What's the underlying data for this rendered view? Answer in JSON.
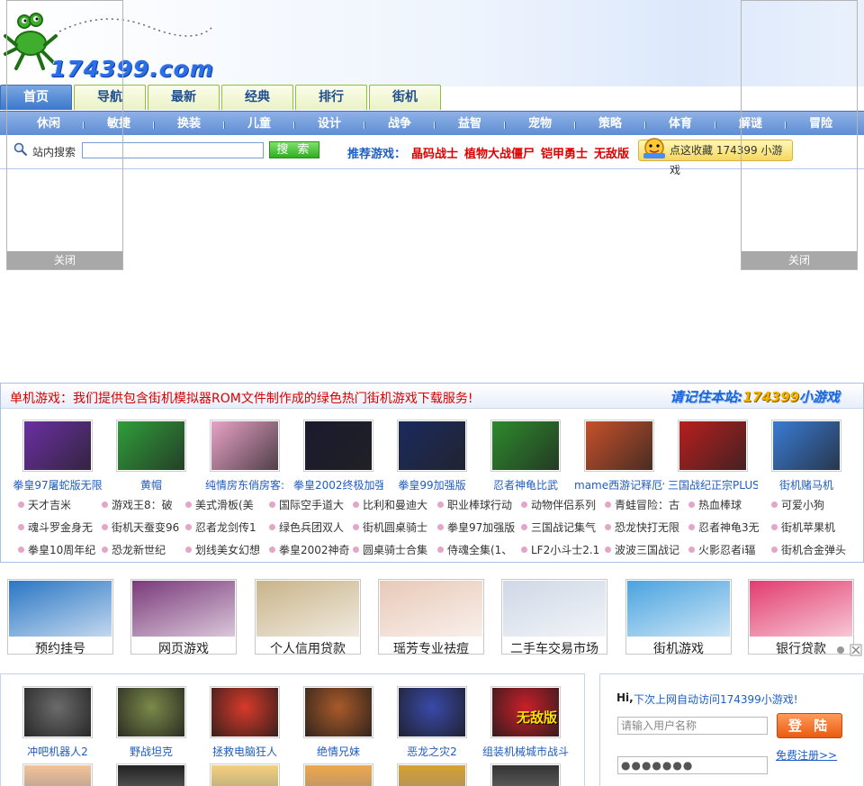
{
  "site": {
    "logo_text": "174399.com"
  },
  "tabs": [
    "首页",
    "导航",
    "最新",
    "经典",
    "排行",
    "街机"
  ],
  "subnav": [
    "休闲",
    "敏捷",
    "换装",
    "儿童",
    "设计",
    "战争",
    "益智",
    "宠物",
    "策略",
    "体育",
    "解谜",
    "冒险"
  ],
  "search": {
    "label": "站内搜索",
    "button": "搜 索",
    "recommend_label": "推荐游戏：",
    "recommend": [
      "晶码战士",
      "植物大战僵尸",
      "铠甲勇士",
      "无敌版"
    ],
    "favorite": "点这收藏 174399 小游戏"
  },
  "float_ads": {
    "close_left": "关闭",
    "close_right": "关闭"
  },
  "pc_section": {
    "title": "单机游戏：我们提供包含街机模拟器ROM文件制作成的绿色热门街机游戏下载服务!",
    "remember_prefix": "请记住本站:",
    "remember_site": "174399",
    "remember_suffix": "小游戏",
    "games": [
      {
        "name": "拳皇97屠蛇版无限",
        "color": "#6b2fa3"
      },
      {
        "name": "黄帽",
        "color": "#2f9e3a"
      },
      {
        "name": "纯情房东俏房客:",
        "color": "#e9a2c7"
      },
      {
        "name": "拳皇2002终极加强",
        "color": "#1a1a2e"
      },
      {
        "name": "拳皇99加强版",
        "color": "#1b2a5e"
      },
      {
        "name": "忍者神龟比武",
        "color": "#2d8a2d"
      },
      {
        "name": "mame西游记释厄传",
        "color": "#c7502a"
      },
      {
        "name": "三国战纪正宗PLUS",
        "color": "#b81e1e"
      },
      {
        "name": "街机赌马机",
        "color": "#3a7bd5"
      }
    ],
    "list": [
      [
        "天才吉米",
        "游戏王8：破",
        "美式滑板(美",
        "国际空手道大",
        "比利和曼迪大",
        "职业棒球行动",
        "动物伴侣系列",
        "青蛙冒险：古",
        "热血棒球",
        "可爱小狗"
      ],
      [
        "魂斗罗金身无",
        "街机天蚕变96",
        "忍者龙剑传1",
        "绿色兵团双人",
        "街机圆桌骑士",
        "拳皇97加强版",
        "三国战记集气",
        "恐龙快打无限",
        "忍者神龟3无",
        "街机苹果机"
      ],
      [
        "拳皇10周年纪",
        "恐龙新世纪",
        "划线美女幻想",
        "拳皇2002神奇",
        "圆桌骑士合集",
        "侍魂全集(1、",
        "LF2小斗士2.1",
        "波波三国战记",
        "火影忍者i辐",
        "街机合金弹头"
      ]
    ]
  },
  "ads": [
    {
      "label": "预约挂号",
      "color": "#2a76c4"
    },
    {
      "label": "网页游戏",
      "color": "#7a3a7a"
    },
    {
      "label": "个人信用贷款",
      "color": "#c9b48a"
    },
    {
      "label": "瑶芳专业祛痘",
      "color": "#e8c9b8"
    },
    {
      "label": "二手车交易市场",
      "color": "#cfd8e6"
    },
    {
      "label": "街机游戏",
      "color": "#4aa3df"
    },
    {
      "label": "银行贷款",
      "color": "#e23c6f"
    }
  ],
  "flash_games": [
    {
      "name": "冲吧机器人2",
      "color": "#6b6b6b"
    },
    {
      "name": "野战坦克",
      "color": "#7b8a4a"
    },
    {
      "name": "拯救电脑狂人",
      "color": "#d73a2a"
    },
    {
      "name": "绝情兄妹",
      "color": "#a85a2a"
    },
    {
      "name": "恶龙之灾2",
      "color": "#3a4aa8"
    },
    {
      "name": "组装机械城市战斗",
      "color": "#c8202a",
      "overlay": "无敌版"
    }
  ],
  "login": {
    "hi": "Hi,",
    "message": "下次上网自动访问174399小游戏!",
    "username_placeholder": "请输入用户名称",
    "password_mask": "●●●●●●●",
    "button": "登 陆",
    "register": "免费注册>>"
  }
}
